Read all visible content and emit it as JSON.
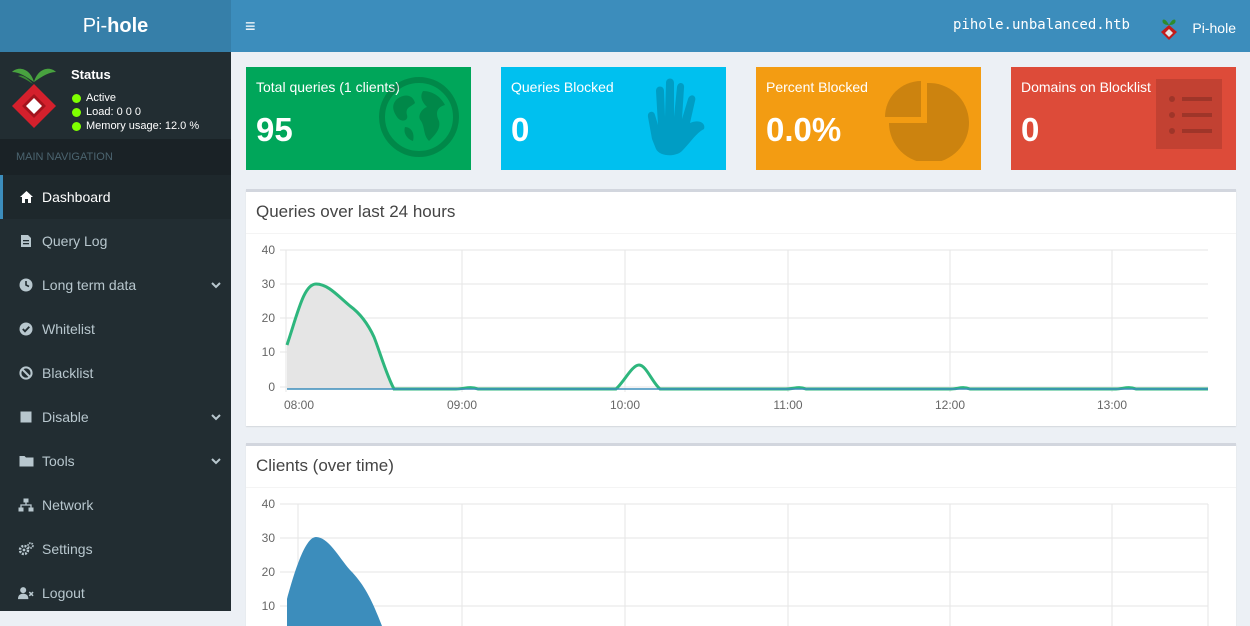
{
  "logo": {
    "pre": "Pi-",
    "bold": "hole"
  },
  "topbar": {
    "menu_icon": "≡",
    "hostname": "pihole.unbalanced.htb",
    "user": "Pi-hole"
  },
  "sidebar": {
    "status": {
      "title": "Status",
      "active": "Active",
      "load": "Load:  0  0  0",
      "memory": "Memory usage:  12.0 %"
    },
    "header": "MAIN NAVIGATION",
    "items": [
      {
        "label": "Dashboard",
        "icon": "home-icon"
      },
      {
        "label": "Query Log",
        "icon": "file-icon"
      },
      {
        "label": "Long term data",
        "icon": "clock-icon"
      },
      {
        "label": "Whitelist",
        "icon": "check-circle-icon"
      },
      {
        "label": "Blacklist",
        "icon": "ban-icon"
      },
      {
        "label": "Disable",
        "icon": "stop-icon"
      },
      {
        "label": "Tools",
        "icon": "folder-icon"
      },
      {
        "label": "Network",
        "icon": "network-icon"
      },
      {
        "label": "Settings",
        "icon": "gears-icon"
      },
      {
        "label": "Logout",
        "icon": "user-times-icon"
      }
    ]
  },
  "stats": [
    {
      "label": "Total queries (1 clients)",
      "value": "95",
      "color": "#00a65a",
      "icon": "globe-icon"
    },
    {
      "label": "Queries Blocked",
      "value": "0",
      "color": "#00c0ef",
      "icon": "hand-icon"
    },
    {
      "label": "Percent Blocked",
      "value": "0.0%",
      "color": "#f39c12",
      "icon": "pie-chart-icon"
    },
    {
      "label": "Domains on Blocklist",
      "value": "0",
      "color": "#dd4b39",
      "icon": "list-icon"
    }
  ],
  "queries_chart": {
    "title": "Queries over last 24 hours",
    "y_ticks": [
      "40",
      "30",
      "20",
      "10",
      "0"
    ],
    "x_ticks": [
      "08:00",
      "09:00",
      "10:00",
      "11:00",
      "12:00",
      "13:00"
    ]
  },
  "clients_chart": {
    "title": "Clients (over time)",
    "y_ticks": [
      "40",
      "30",
      "20",
      "10"
    ]
  }
}
